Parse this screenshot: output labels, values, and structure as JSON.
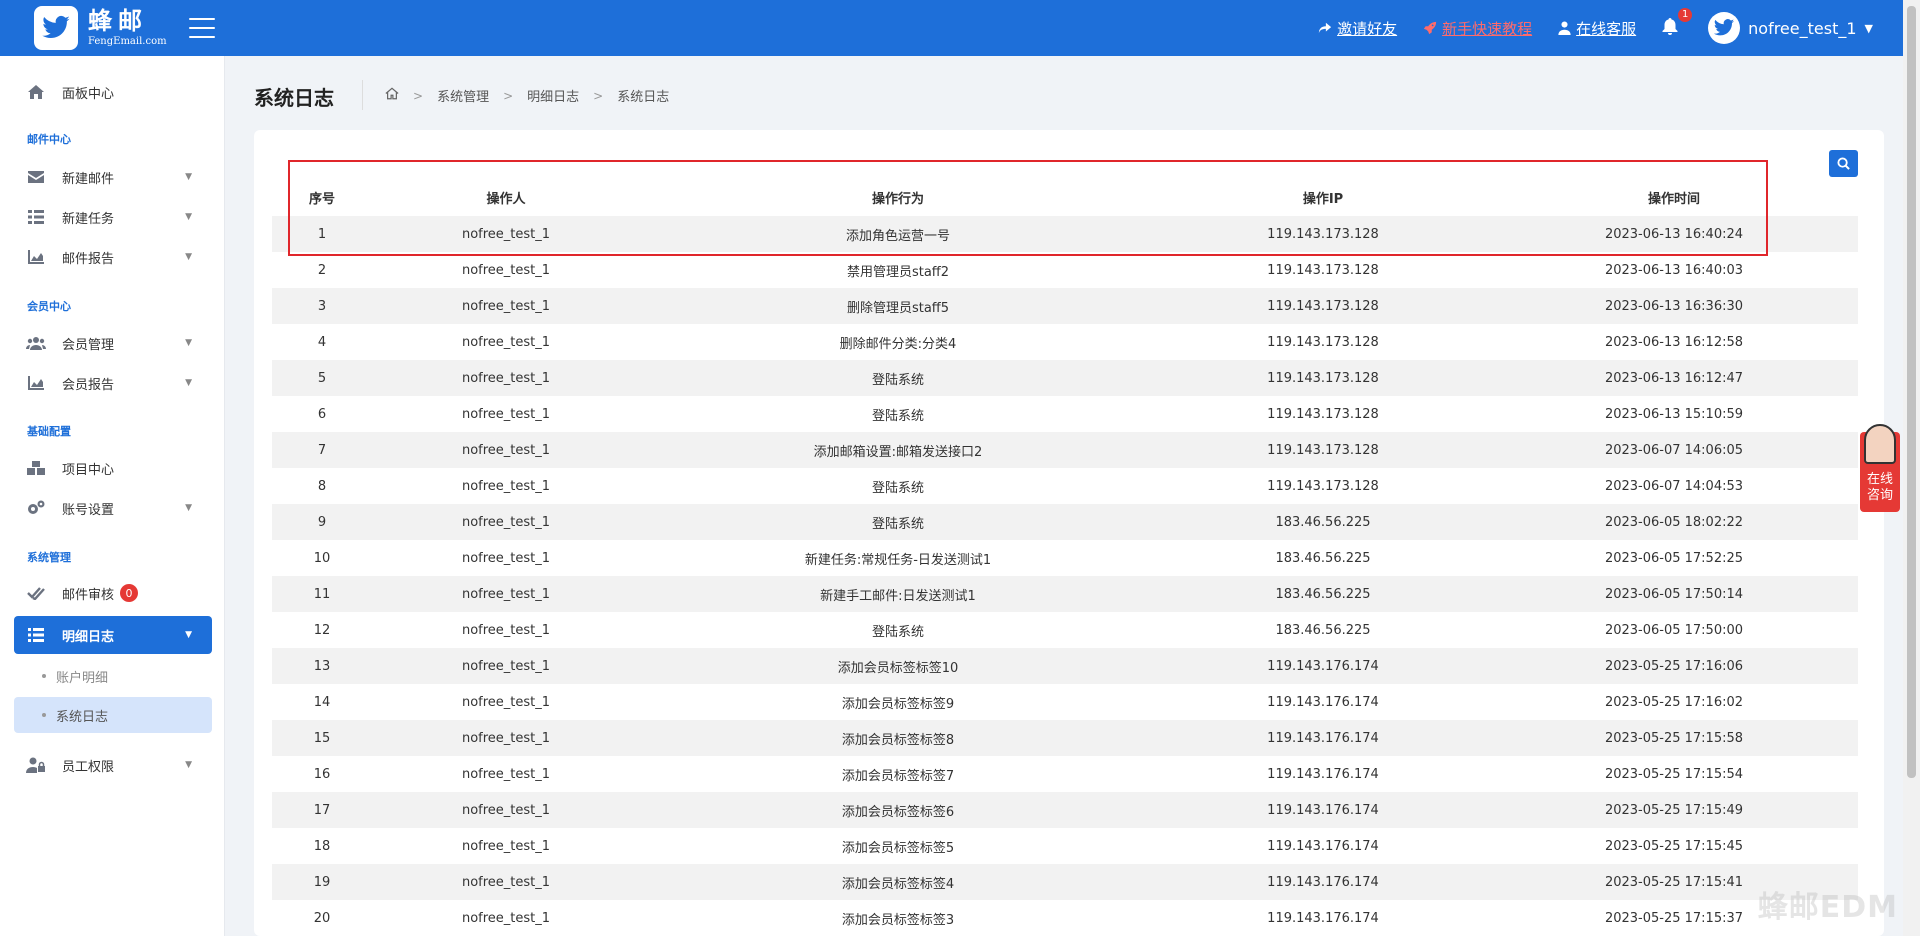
{
  "brand": {
    "name": "蜂邮",
    "sub": "FengEmail.com"
  },
  "topbar": {
    "invite": "邀请好友",
    "tutorial": "新手快速教程",
    "support": "在线客服",
    "notifications": "1",
    "username": "nofree_test_1"
  },
  "sidebar": {
    "dashboard": "面板中心",
    "section_mail": "邮件中心",
    "new_mail": "新建邮件",
    "new_task": "新建任务",
    "mail_report": "邮件报告",
    "section_member": "会员中心",
    "member_manage": "会员管理",
    "member_report": "会员报告",
    "section_base": "基础配置",
    "project_center": "项目中心",
    "account_settings": "账号设置",
    "section_system": "系统管理",
    "mail_review": "邮件审核",
    "mail_review_count": "0",
    "detail_log": "明细日志",
    "account_detail": "账户明细",
    "system_log": "系统日志",
    "staff_permission": "员工权限"
  },
  "page": {
    "title": "系统日志",
    "breadcrumb": [
      "系统管理",
      "明细日志",
      "系统日志"
    ]
  },
  "table": {
    "headers": [
      "序号",
      "操作人",
      "操作行为",
      "操作IP",
      "操作时间"
    ],
    "rows": [
      [
        "1",
        "nofree_test_1",
        "添加角色运营一号",
        "119.143.173.128",
        "2023-06-13 16:40:24"
      ],
      [
        "2",
        "nofree_test_1",
        "禁用管理员staff2",
        "119.143.173.128",
        "2023-06-13 16:40:03"
      ],
      [
        "3",
        "nofree_test_1",
        "删除管理员staff5",
        "119.143.173.128",
        "2023-06-13 16:36:30"
      ],
      [
        "4",
        "nofree_test_1",
        "删除邮件分类:分类4",
        "119.143.173.128",
        "2023-06-13 16:12:58"
      ],
      [
        "5",
        "nofree_test_1",
        "登陆系统",
        "119.143.173.128",
        "2023-06-13 16:12:47"
      ],
      [
        "6",
        "nofree_test_1",
        "登陆系统",
        "119.143.173.128",
        "2023-06-13 15:10:59"
      ],
      [
        "7",
        "nofree_test_1",
        "添加邮箱设置:邮箱发送接口2",
        "119.143.173.128",
        "2023-06-07 14:06:05"
      ],
      [
        "8",
        "nofree_test_1",
        "登陆系统",
        "119.143.173.128",
        "2023-06-07 14:04:53"
      ],
      [
        "9",
        "nofree_test_1",
        "登陆系统",
        "183.46.56.225",
        "2023-06-05 18:02:22"
      ],
      [
        "10",
        "nofree_test_1",
        "新建任务:常规任务-日发送测试1",
        "183.46.56.225",
        "2023-06-05 17:52:25"
      ],
      [
        "11",
        "nofree_test_1",
        "新建手工邮件:日发送测试1",
        "183.46.56.225",
        "2023-06-05 17:50:14"
      ],
      [
        "12",
        "nofree_test_1",
        "登陆系统",
        "183.46.56.225",
        "2023-06-05 17:50:00"
      ],
      [
        "13",
        "nofree_test_1",
        "添加会员标签标签10",
        "119.143.176.174",
        "2023-05-25 17:16:06"
      ],
      [
        "14",
        "nofree_test_1",
        "添加会员标签标签9",
        "119.143.176.174",
        "2023-05-25 17:16:02"
      ],
      [
        "15",
        "nofree_test_1",
        "添加会员标签标签8",
        "119.143.176.174",
        "2023-05-25 17:15:58"
      ],
      [
        "16",
        "nofree_test_1",
        "添加会员标签标签7",
        "119.143.176.174",
        "2023-05-25 17:15:54"
      ],
      [
        "17",
        "nofree_test_1",
        "添加会员标签标签6",
        "119.143.176.174",
        "2023-05-25 17:15:49"
      ],
      [
        "18",
        "nofree_test_1",
        "添加会员标签标签5",
        "119.143.176.174",
        "2023-05-25 17:15:45"
      ],
      [
        "19",
        "nofree_test_1",
        "添加会员标签标签4",
        "119.143.176.174",
        "2023-05-25 17:15:41"
      ],
      [
        "20",
        "nofree_test_1",
        "添加会员标签标签3",
        "119.143.176.174",
        "2023-05-25 17:15:37"
      ]
    ]
  },
  "consult": {
    "line1": "在线",
    "line2": "咨询"
  },
  "watermark": "蜂邮EDM",
  "colors": {
    "primary": "#1e6fd9",
    "danger": "#e53935",
    "highlight": "#e0262b"
  }
}
